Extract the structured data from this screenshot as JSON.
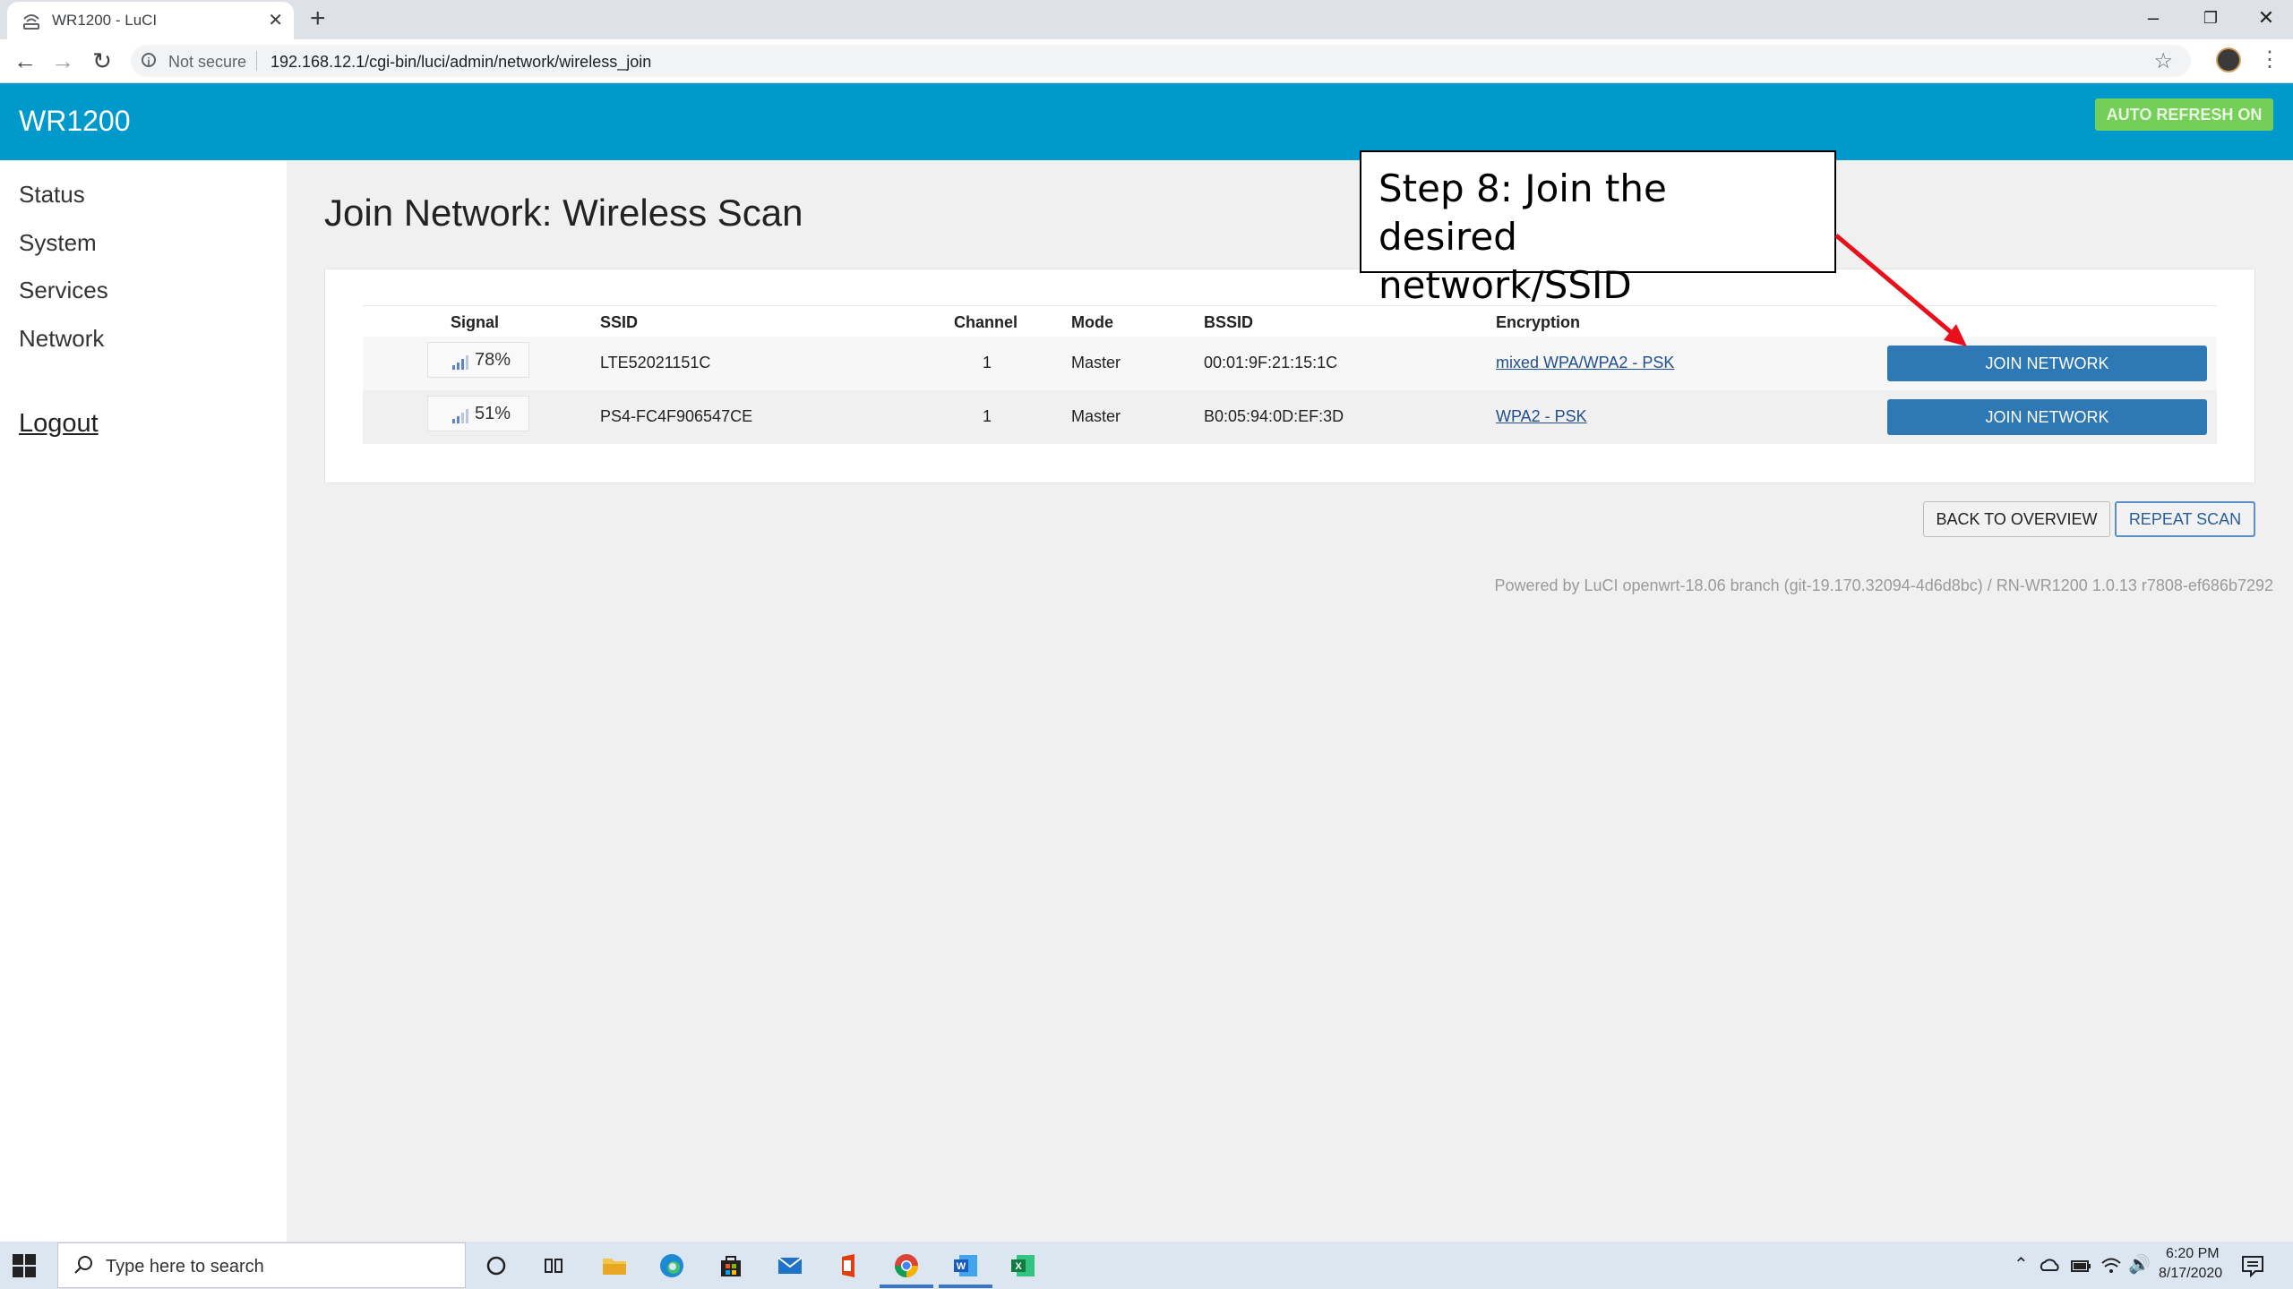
{
  "browser": {
    "tab_title": "WR1200 - LuCI",
    "tab_close": "✕",
    "new_tab": "+",
    "not_secure": "Not secure",
    "url": "192.168.12.1/cgi-bin/luci/admin/network/wireless_join"
  },
  "header": {
    "brand": "WR1200",
    "auto_refresh": "AUTO REFRESH ON"
  },
  "sidebar": {
    "items": [
      "Status",
      "System",
      "Services",
      "Network"
    ],
    "logout": "Logout"
  },
  "main": {
    "title": "Join Network: Wireless Scan",
    "columns": [
      "Signal",
      "SSID",
      "Channel",
      "Mode",
      "BSSID",
      "Encryption"
    ],
    "rows": [
      {
        "signal": "78%",
        "ssid": "LTE52021151C",
        "channel": "1",
        "mode": "Master",
        "bssid": "00:01:9F:21:15:1C",
        "encryption": "mixed WPA/WPA2 - PSK",
        "action": "JOIN NETWORK"
      },
      {
        "signal": "51%",
        "ssid": "PS4-FC4F906547CE",
        "channel": "1",
        "mode": "Master",
        "bssid": "B0:05:94:0D:EF:3D",
        "encryption": "WPA2 - PSK",
        "action": "JOIN NETWORK"
      }
    ],
    "back_button": "BACK TO OVERVIEW",
    "repeat_button": "REPEAT SCAN",
    "footer": "Powered by LuCI openwrt-18.06 branch (git-19.170.32094-4d6d8bc) / RN-WR1200 1.0.13 r7808-ef686b7292"
  },
  "callout": {
    "line1": "Step 8: Join the desired",
    "line2": "network/SSID"
  },
  "taskbar": {
    "search_placeholder": "Type here to search",
    "time": "6:20 PM",
    "date": "8/17/2020"
  },
  "colors": {
    "header": "#0099cc",
    "auto_refresh": "#75ce57",
    "join_button": "#2f78b6",
    "arrow": "#e8101a"
  }
}
